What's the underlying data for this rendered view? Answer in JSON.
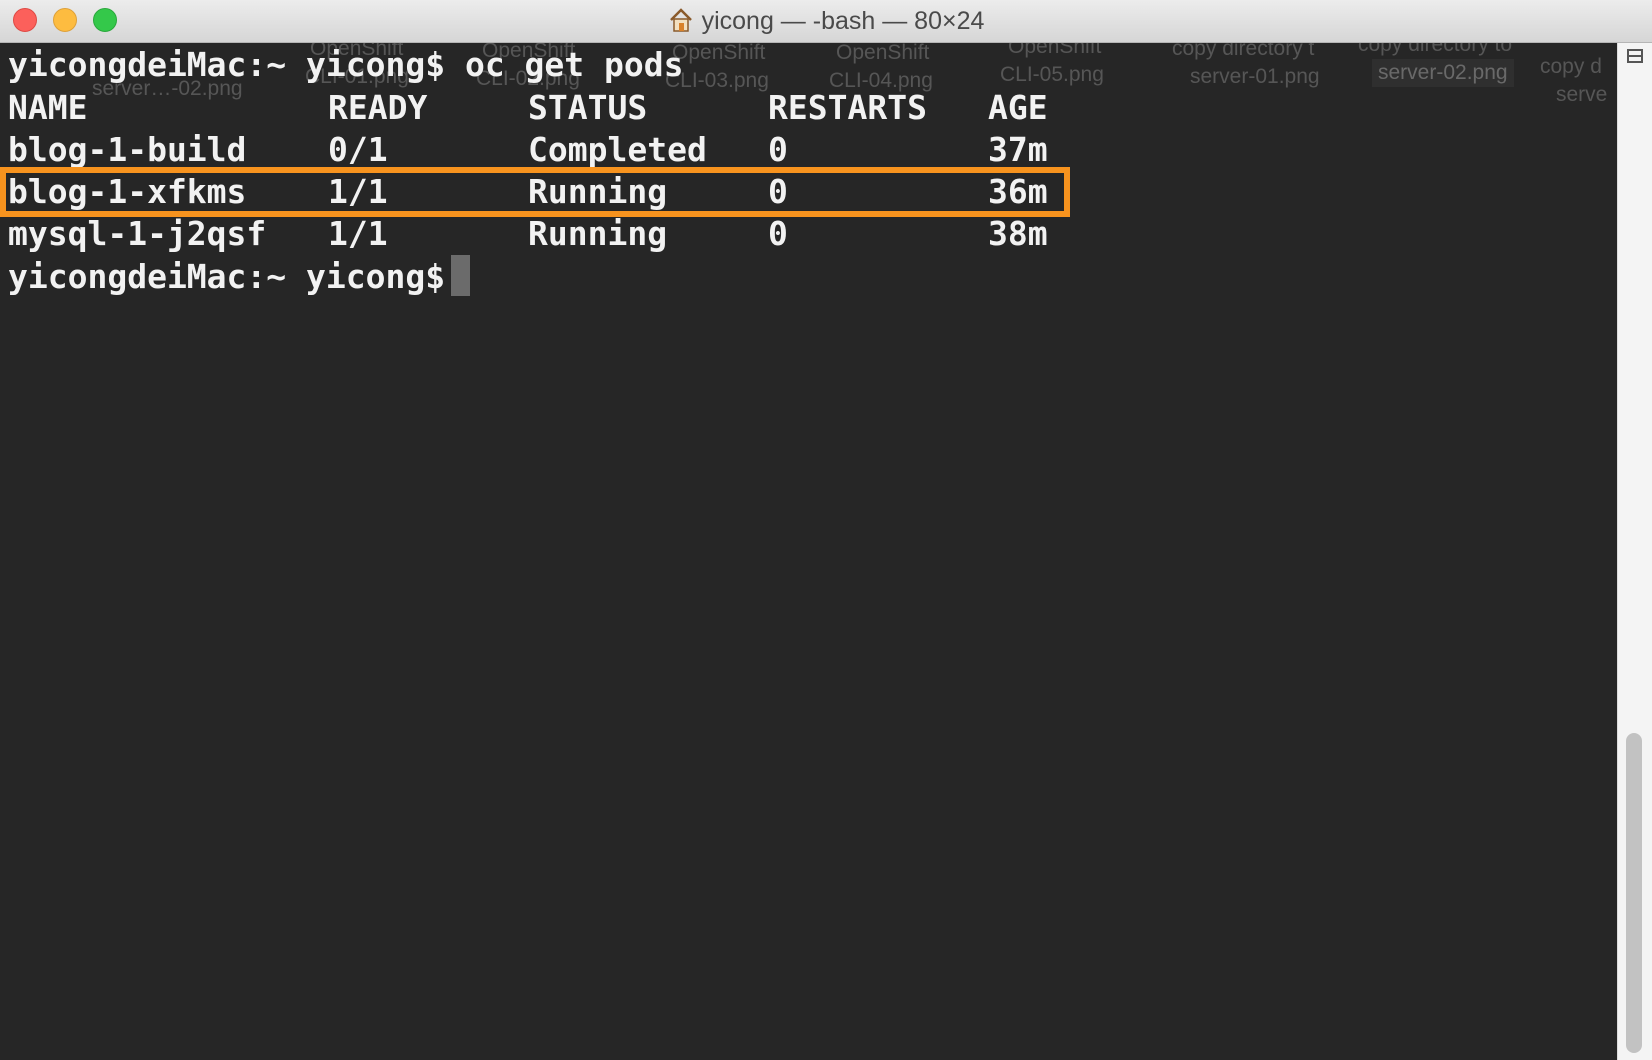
{
  "window": {
    "title": "yicong — -bash — 80×24"
  },
  "desktop_ghost_labels": [
    "server…-02.png",
    "OpenShift",
    "CLI-01.png",
    "OpenShift",
    "CLI-02.png",
    "OpenShift",
    "CLI-03.png",
    "OpenShift",
    "CLI-04.png",
    "OpenShift",
    "CLI-05.png",
    "copy directory t",
    "server-01.png",
    "copy directory to",
    "server-02.png",
    "copy d",
    "serve"
  ],
  "terminal": {
    "command_line": "yicongdeiMac:~ yicong$ oc get pods",
    "headers": [
      "NAME",
      "READY",
      "STATUS",
      "RESTARTS",
      "AGE"
    ],
    "rows": [
      [
        "blog-1-build",
        "0/1",
        "Completed",
        "0",
        "37m"
      ],
      [
        "blog-1-xfkms",
        "1/1",
        "Running",
        "0",
        "36m"
      ],
      [
        "mysql-1-j2qsf",
        "1/1",
        "Running",
        "0",
        "38m"
      ]
    ],
    "prompt": "yicongdeiMac:~ yicong$",
    "highlighted_row_index": 1
  },
  "colors": {
    "background": "#262626",
    "text": "#f2f2f2",
    "highlight": "#f7931e"
  },
  "icons": {
    "title_icon": "home-icon",
    "scrollbar_icon": "split-pane-icon"
  }
}
